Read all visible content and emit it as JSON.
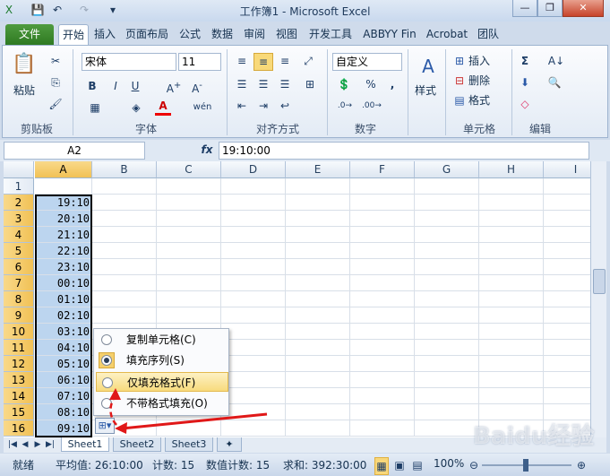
{
  "window": {
    "title": "工作簿1 - Microsoft Excel"
  },
  "quick_access": {
    "save": "💾",
    "undo": "↶",
    "redo": "↷",
    "customize": "▾"
  },
  "tabs": [
    "文件",
    "开始",
    "插入",
    "页面布局",
    "公式",
    "数据",
    "审阅",
    "视图",
    "开发工具",
    "ABBYY Fin",
    "Acrobat",
    "团队"
  ],
  "ribbon": {
    "clipboard": {
      "paste": "粘贴",
      "label": "剪贴板"
    },
    "font": {
      "name": "宋体",
      "size": "11",
      "label": "字体",
      "bold": "B",
      "italic": "I",
      "underline": "U"
    },
    "alignment": {
      "label": "对齐方式"
    },
    "number": {
      "format": "自定义",
      "label": "数字",
      "percent": "%",
      "comma": ","
    },
    "styles": {
      "label": "样式"
    },
    "cells": {
      "insert": "插入",
      "delete": "删除",
      "format": "格式",
      "label": "单元格"
    },
    "editing": {
      "label": "编辑",
      "sum": "Σ"
    }
  },
  "formula_bar": {
    "name_box": "A2",
    "fx": "fx",
    "value": "19:10:00"
  },
  "columns": [
    "A",
    "B",
    "C",
    "D",
    "E",
    "F",
    "G",
    "H",
    "I"
  ],
  "rows": [
    "1",
    "2",
    "3",
    "4",
    "5",
    "6",
    "7",
    "8",
    "9",
    "10",
    "11",
    "12",
    "13",
    "14",
    "15",
    "16"
  ],
  "cells_a": [
    "",
    "19:10",
    "20:10",
    "21:10",
    "22:10",
    "23:10",
    "00:10",
    "01:10",
    "02:10",
    "03:10",
    "04:10",
    "05:10",
    "06:10",
    "07:10",
    "08:10",
    "09:10"
  ],
  "autofill_menu": {
    "options": [
      "复制单元格(C)",
      "填充序列(S)",
      "仅填充格式(F)",
      "不带格式填充(O)"
    ],
    "selected_index": 1,
    "hover_index": 2
  },
  "sheets": [
    "Sheet1",
    "Sheet2",
    "Sheet3"
  ],
  "status": {
    "mode": "就绪",
    "average": "平均值: 26:10:00",
    "count": "计数: 15",
    "numeric_count": "数值计数: 15",
    "sum": "求和: 392:30:00",
    "zoom": "100%"
  },
  "watermark": "Baidu经验"
}
